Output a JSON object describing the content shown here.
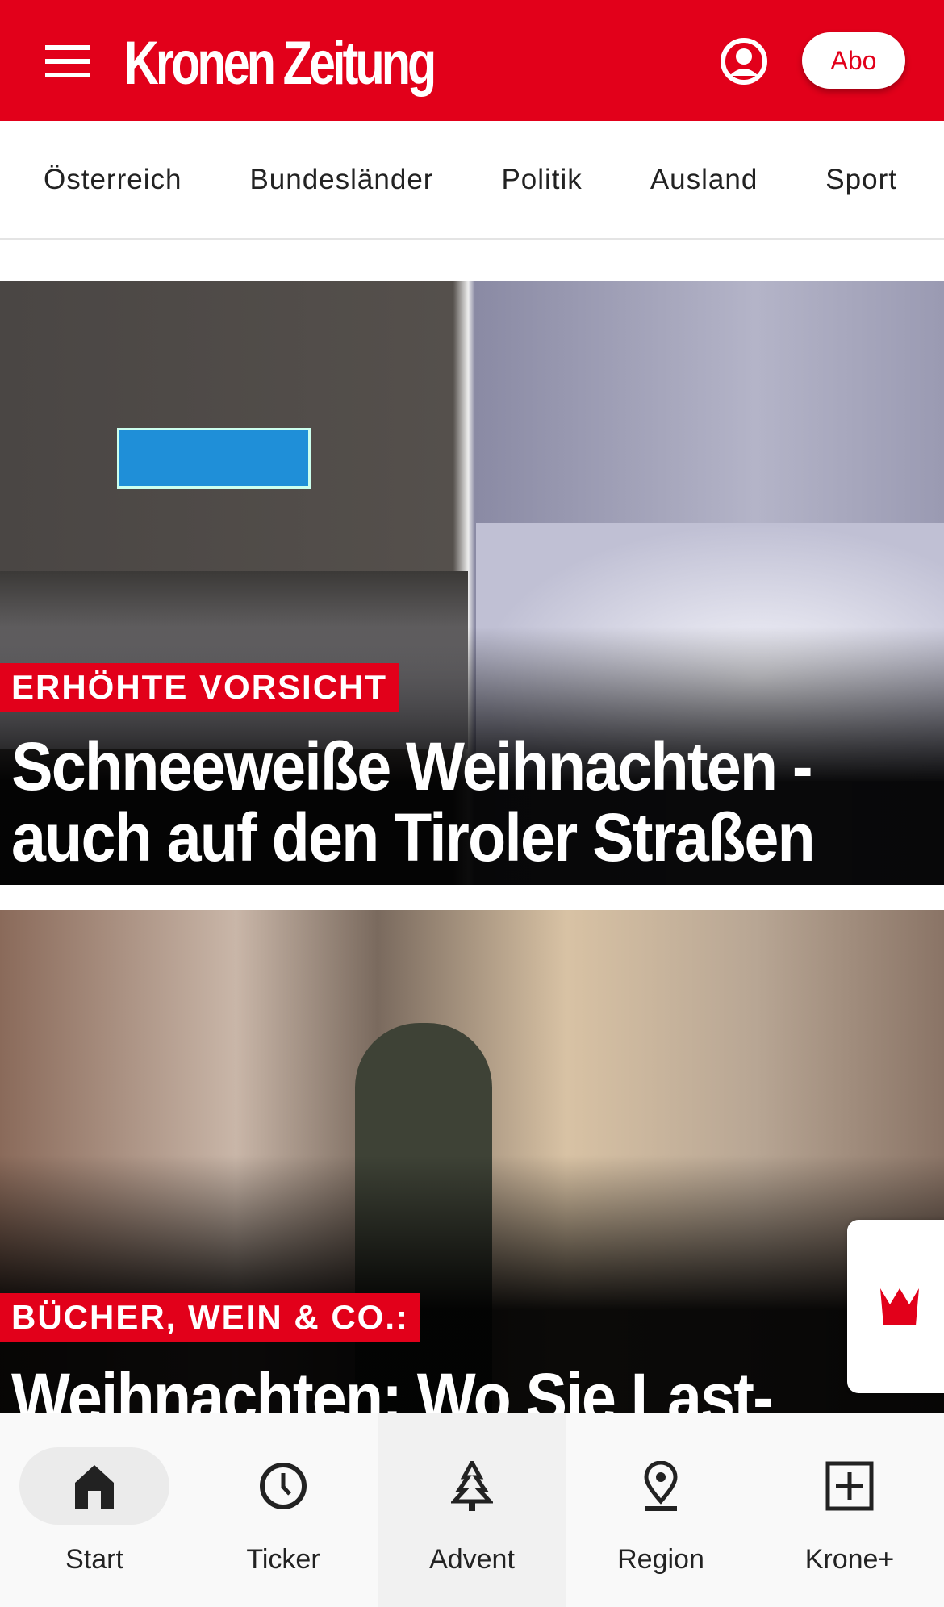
{
  "header": {
    "logo": "Kronen Zeitung",
    "abo_label": "Abo",
    "brand_color": "#e2001a"
  },
  "nav": {
    "items": [
      "Österreich",
      "Bundesländer",
      "Politik",
      "Ausland",
      "Sport"
    ]
  },
  "articles": [
    {
      "tag": "ERHÖHTE VORSICHT",
      "headline": "Schneeweiße Weihnachten - auch auf den Tiroler Straßen"
    },
    {
      "tag": "BÜCHER, WEIN & CO.:",
      "headline": "Weihnachten: Wo Sie Last-"
    }
  ],
  "bottom_nav": [
    {
      "label": "Start",
      "icon": "home-icon"
    },
    {
      "label": "Ticker",
      "icon": "clock-icon"
    },
    {
      "label": "Advent",
      "icon": "tree-icon"
    },
    {
      "label": "Region",
      "icon": "location-pin-icon"
    },
    {
      "label": "Krone+",
      "icon": "plus-box-icon"
    }
  ]
}
